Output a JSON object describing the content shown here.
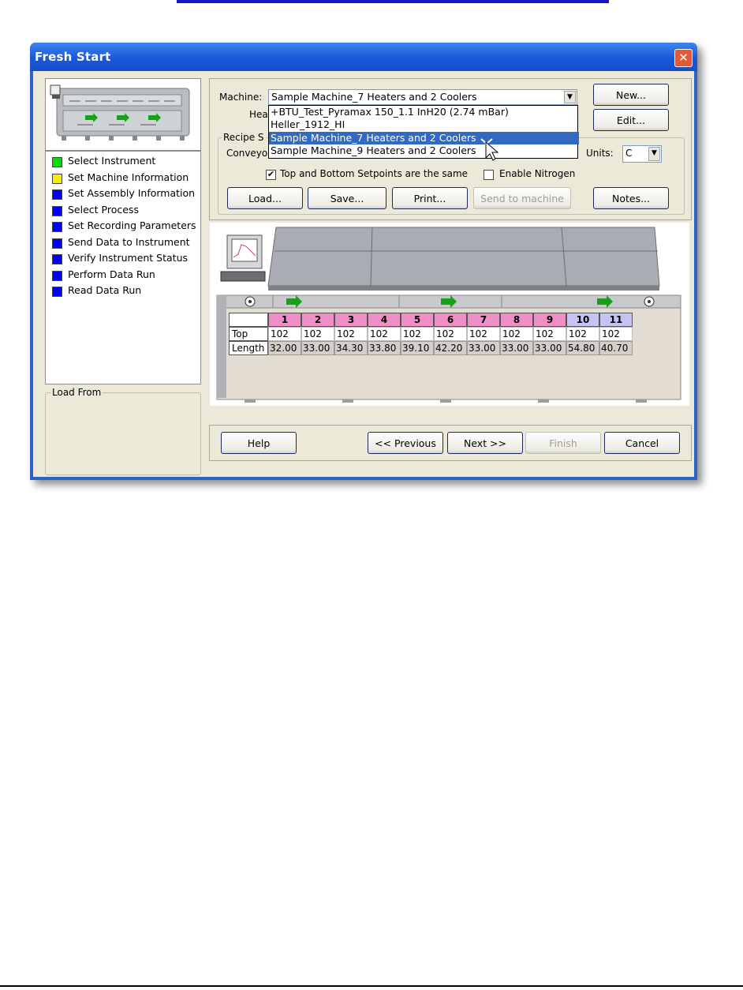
{
  "window": {
    "title": "Fresh Start",
    "close_glyph": "✕"
  },
  "steps": [
    {
      "label": "Select Instrument",
      "color": "#00e000"
    },
    {
      "label": "Set Machine Information",
      "color": "#f0f000"
    },
    {
      "label": "Set Assembly Information",
      "color": "#0000ff"
    },
    {
      "label": "Select Process",
      "color": "#0000ff"
    },
    {
      "label": "Set Recording Parameters",
      "color": "#0000ff"
    },
    {
      "label": "Send Data to Instrument",
      "color": "#0000ff"
    },
    {
      "label": "Verify Instrument Status",
      "color": "#0000ff"
    },
    {
      "label": "Perform Data Run",
      "color": "#0000ff"
    },
    {
      "label": "Read Data Run",
      "color": "#0000ff"
    }
  ],
  "load_from_label": "Load From",
  "machine": {
    "label": "Machine:",
    "value": "Sample Machine_7 Heaters and 2 Coolers",
    "options": [
      "+BTU_Test_Pyramax 150_1.1 InH20 (2.74 mBar)",
      "Heller_1912_HI",
      "Sample Machine_7 Heaters and 2 Coolers",
      "Sample Machine_9 Heaters and 2 Coolers"
    ],
    "selected_index": 2
  },
  "partial_labels": {
    "heaters": "Hea",
    "recipe": "Recipe S",
    "conveyor": "Conveyo",
    "units": "Units:"
  },
  "units_value": "C",
  "checkboxes": {
    "same_setpoints": {
      "label": "Top and Bottom Setpoints are the same",
      "checked": true
    },
    "nitrogen": {
      "label": "Enable Nitrogen",
      "checked": false
    }
  },
  "buttons": {
    "new": "New...",
    "edit": "Edit...",
    "load": "Load...",
    "save": "Save...",
    "print": "Print...",
    "send": "Send to machine",
    "notes": "Notes...",
    "help": "Help",
    "previous": "<< Previous",
    "next": "Next >>",
    "finish": "Finish",
    "cancel": "Cancel"
  },
  "zones": {
    "row_labels": {
      "top": "Top",
      "length": "Length"
    },
    "zones": [
      {
        "num": "1",
        "top": "102",
        "length": "32.00",
        "kind": "heater"
      },
      {
        "num": "2",
        "top": "102",
        "length": "33.00",
        "kind": "heater"
      },
      {
        "num": "3",
        "top": "102",
        "length": "34.30",
        "kind": "heater"
      },
      {
        "num": "4",
        "top": "102",
        "length": "33.80",
        "kind": "heater"
      },
      {
        "num": "5",
        "top": "102",
        "length": "39.10",
        "kind": "heater"
      },
      {
        "num": "6",
        "top": "102",
        "length": "42.20",
        "kind": "heater"
      },
      {
        "num": "7",
        "top": "102",
        "length": "33.00",
        "kind": "heater"
      },
      {
        "num": "8",
        "top": "102",
        "length": "33.00",
        "kind": "heater"
      },
      {
        "num": "9",
        "top": "102",
        "length": "33.00",
        "kind": "heater"
      },
      {
        "num": "10",
        "top": "102",
        "length": "54.80",
        "kind": "cooler"
      },
      {
        "num": "11",
        "top": "102",
        "length": "40.70",
        "kind": "cooler"
      }
    ]
  },
  "colors": {
    "heater": "#f08ec8",
    "cooler": "#c4c4f4",
    "selection": "#316ac5",
    "titlebar": "#1b58d6"
  }
}
